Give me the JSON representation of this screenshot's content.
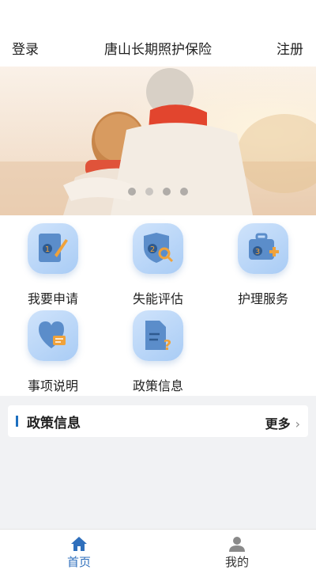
{
  "header": {
    "login": "登录",
    "title": "唐山长期照护保险",
    "register": "注册"
  },
  "banner": {
    "slide_count": 4,
    "active_index": 0
  },
  "services": [
    {
      "label": "我要申请",
      "icon": "apply-icon"
    },
    {
      "label": "失能评估",
      "icon": "assessment-icon"
    },
    {
      "label": "护理服务",
      "icon": "care-service-icon"
    },
    {
      "label": "事项说明",
      "icon": "instructions-icon"
    },
    {
      "label": "政策信息",
      "icon": "policy-info-icon"
    }
  ],
  "policy": {
    "title": "政策信息",
    "more": "更多"
  },
  "tabbar": {
    "home": "首页",
    "mine": "我的"
  },
  "colors": {
    "accent": "#2f6fbc",
    "icon_bg": "#bcd8f8",
    "icon_orange": "#f0a23a"
  }
}
